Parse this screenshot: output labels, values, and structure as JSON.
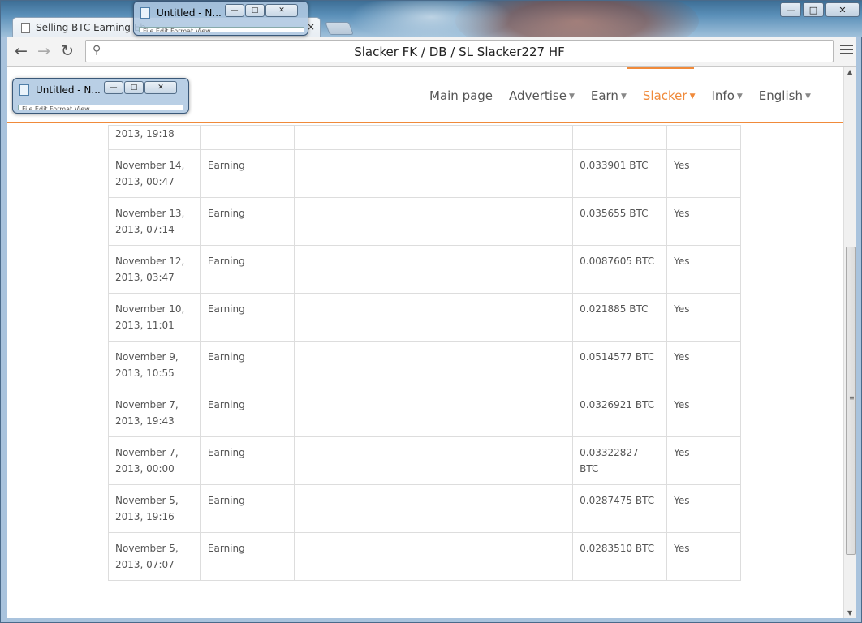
{
  "browser": {
    "tab_title": "Selling BTC Earning Eb",
    "tab_close": "×",
    "address": "Slacker FK / DB / SL   Slacker227 HF",
    "win_minimize": "—",
    "win_maximize": "□",
    "win_close": "✕"
  },
  "nav": {
    "items": [
      {
        "label": "Main page",
        "has_caret": false
      },
      {
        "label": "Advertise",
        "has_caret": true
      },
      {
        "label": "Earn",
        "has_caret": true
      },
      {
        "label": "Slacker",
        "has_caret": true,
        "active": true
      },
      {
        "label": "Info",
        "has_caret": true
      },
      {
        "label": "English",
        "has_caret": true
      }
    ],
    "accent_color": "#f08a3a"
  },
  "table": {
    "first_row": {
      "date": "2013, 19:18"
    },
    "rows": [
      {
        "date1": "November 14,",
        "date2": "2013, 00:47",
        "type": "Earning",
        "desc": "",
        "amount": "0.033901 BTC",
        "paid": "Yes"
      },
      {
        "date1": "November 13,",
        "date2": "2013, 07:14",
        "type": "Earning",
        "desc": "",
        "amount": "0.035655 BTC",
        "paid": "Yes"
      },
      {
        "date1": "November 12,",
        "date2": "2013, 03:47",
        "type": "Earning",
        "desc": "",
        "amount": "0.0087605 BTC",
        "paid": "Yes"
      },
      {
        "date1": "November 10,",
        "date2": "2013, 11:01",
        "type": "Earning",
        "desc": "",
        "amount": "0.021885 BTC",
        "paid": "Yes"
      },
      {
        "date1": "November 9,",
        "date2": "2013, 10:55",
        "type": "Earning",
        "desc": "",
        "amount": "0.0514577 BTC",
        "paid": "Yes"
      },
      {
        "date1": "November 7,",
        "date2": "2013, 19:43",
        "type": "Earning",
        "desc": "",
        "amount": "0.0326921 BTC",
        "paid": "Yes"
      },
      {
        "date1": "November 7,",
        "date2": "2013, 00:00",
        "type": "Earning",
        "desc": "",
        "amount": "0.03322827 BTC",
        "paid": "Yes"
      },
      {
        "date1": "November 5,",
        "date2": "2013, 19:16",
        "type": "Earning",
        "desc": "",
        "amount": "0.0287475 BTC",
        "paid": "Yes"
      },
      {
        "date1": "November 5,",
        "date2": "2013, 07:07",
        "type": "Earning",
        "desc": "",
        "amount": "0.0283510 BTC",
        "paid": "Yes"
      }
    ]
  },
  "notepads": [
    {
      "title": "Untitled - N...",
      "menu": "File  Edit  Format  View"
    },
    {
      "title": "Untitled - N...",
      "menu": "File  Edit  Format  View"
    }
  ]
}
